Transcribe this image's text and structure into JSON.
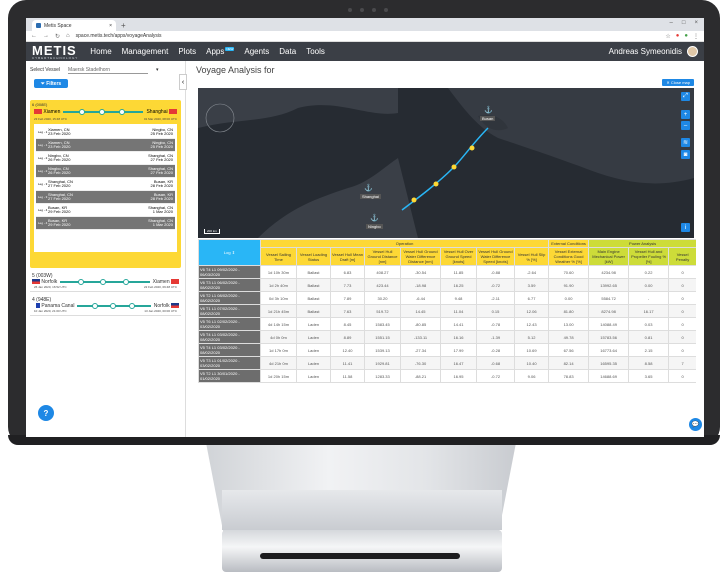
{
  "browser": {
    "tab_title": "Metis Space",
    "url": "space.metis.tech/apps/voyageAnalysis"
  },
  "app": {
    "logo": "METIS",
    "logo_sub": "CYBERTECHNOLOGY",
    "nav": [
      "Home",
      "Management",
      "Plots",
      "Apps",
      "Agents",
      "Data",
      "Tools"
    ],
    "new_badge": "NEW",
    "user_name": "Andreas Symeonidis"
  },
  "sidebar": {
    "select_label": "Select Vessel",
    "vessel": "Maersk Stadelhorn",
    "filters_label": "Filters",
    "voyage1": {
      "id": "6 (008E)",
      "from": "Xiamen",
      "to": "Shanghai",
      "start": "23 Feb 2020, 15:48 UTC",
      "end": "01 Mar 2020, 08:00 UTC",
      "legs": [
        {
          "no": "Leg - 1",
          "from": "Xiamen, CN",
          "fdate": "23 Feb 2020",
          "to": "Ningbo, CN",
          "tdate": "25 Feb 2020",
          "dark": false
        },
        {
          "no": "Leg - 1",
          "from": "Xiamen, CN",
          "fdate": "23 Feb 2020",
          "to": "Ningbo, CN",
          "tdate": "25 Feb 2020",
          "dark": true
        },
        {
          "no": "Leg - 2",
          "from": "Ningbo, CN",
          "fdate": "26 Feb 2020",
          "to": "Shanghai, CN",
          "tdate": "27 Feb 2020",
          "dark": false
        },
        {
          "no": "Leg - 2",
          "from": "Ningbo, CN",
          "fdate": "26 Feb 2020",
          "to": "Shanghai, CN",
          "tdate": "27 Feb 2020",
          "dark": true
        },
        {
          "no": "Leg - 3",
          "from": "Shanghai, CN",
          "fdate": "27 Feb 2020",
          "to": "Busan, KR",
          "tdate": "28 Feb 2020",
          "dark": false
        },
        {
          "no": "Leg - 3",
          "from": "Shanghai, CN",
          "fdate": "27 Feb 2020",
          "to": "Busan, KR",
          "tdate": "28 Feb 2020",
          "dark": true
        },
        {
          "no": "Leg - 4",
          "from": "Busan, KR",
          "fdate": "29 Feb 2020",
          "to": "Shanghai, CN",
          "tdate": "1 Mar 2020",
          "dark": false
        },
        {
          "no": "Leg - 4",
          "from": "Busan, KR",
          "fdate": "29 Feb 2020",
          "to": "Shanghai, CN",
          "tdate": "1 Mar 2020",
          "dark": true
        }
      ]
    },
    "voyage2": {
      "id": "5 (003W)",
      "from": "Norfolk",
      "to": "Xiamen",
      "start": "26 Jan 2020, 16:52 UTC",
      "end": "22 Feb 2020, 09:48 UTC"
    },
    "voyage3": {
      "id": "4 (948E)",
      "from": "Panama Canal",
      "to": "Norfolk",
      "start": "10 Jan 2020, 21:00 UTC",
      "end": "13 Jan 2020, 00:00 UTC"
    },
    "help": "?"
  },
  "main": {
    "title": "Voyage Analysis for",
    "close_map": "Close map",
    "map_labels": [
      "Busan",
      "Shanghai",
      "Ningbo"
    ],
    "scale": "200 km",
    "info": "i",
    "headers": {
      "log": "Log",
      "operation": "Operation",
      "external": "External Conditions",
      "power": "Power Analysis",
      "cols": [
        "Vessel Sailing Time",
        "Vessel Loading Status",
        "Vessel Hull Mean Draft [m]",
        "Vessel Hull Ground Distance [nm]",
        "Vessel Hull Ground Water Difference Distance [nm]",
        "Vessel Hull Over Ground Speed [knots]",
        "Vessel Hull Ground Water Difference Speed [knots]",
        "Vessel Hull Slip % [%]",
        "Vessel External Conditions Good Weather % [%]",
        "Main Engine Mechanical Power [kW]",
        "Vessel Hull and Propeller Fouling % [%]",
        "Vessel Penalty"
      ]
    },
    "rows": [
      [
        "V6 T4 L1 09/02/2020 - 06/03/2020",
        "1d 10h 30m",
        "Ballast",
        "6.83",
        "408.27",
        "-30.54",
        "11.85",
        "-0.88",
        "-2.64",
        "70.60",
        "4234.98",
        "0.22",
        "0"
      ],
      [
        "V6 T3 L1 06/02/2020 - 08/02/2020",
        "1d 2h 40m",
        "Ballast",
        "7.73",
        "423.44",
        "-18.98",
        "16.25",
        "-0.72",
        "3.59",
        "91.90",
        "13992.65",
        "0.00",
        "0"
      ],
      [
        "V6 T2 L1 08/02/2020 - 08/02/2020",
        "0d 3h 10m",
        "Ballast",
        "7.89",
        "30.20",
        "-6.44",
        "9.48",
        "-2.11",
        "6.77",
        "0.00",
        "5584.72",
        "-",
        "0"
      ],
      [
        "V6 T1 L1 07/02/2020 - 08/02/2020",
        "1d 21h 45m",
        "Ballast",
        "7.63",
        "519.72",
        "14.45",
        "11.04",
        "0.15",
        "12.06",
        "81.80",
        "8274.98",
        "16.17",
        "0"
      ],
      [
        "V5 T6 L1 02/02/2020 - 03/02/2020",
        "4d 14h 15m",
        "Laden",
        "8.45",
        "1583.45",
        "-80.85",
        "14.41",
        "-0.78",
        "12.43",
        "13.00",
        "14088.49",
        "0.03",
        "0"
      ],
      [
        "V5 T4 L1 03/02/2020 - 08/02/2020",
        "4d 0h 0m",
        "Laden",
        "8.89",
        "1551.15",
        "-133.11",
        "16.16",
        "-1.39",
        "5.12",
        "49.78",
        "15783.56",
        "0.81",
        "0"
      ],
      [
        "V5 T4 L1 03/02/2020 - 08/02/2020",
        "1d 17h 0m",
        "Laden",
        "12.40",
        "1539.13",
        "-27.34",
        "17.99",
        "-0.28",
        "10.69",
        "67.56",
        "16773.64",
        "2.15",
        "0"
      ],
      [
        "V5 T3 L1 01/02/2020 - 03/02/2020",
        "4d 21h 0m",
        "Laden",
        "11.41",
        "1929.81",
        "-76.30",
        "16.47",
        "-0.68",
        "10.40",
        "82.14",
        "16595.35",
        "8.58",
        "7"
      ],
      [
        "V5 T2 L1 30/01/2020 - 01/02/2020",
        "1d 20h 15m",
        "Laden",
        "11.58",
        "1283.33",
        "-88.21",
        "16.95",
        "-0.72",
        "9.06",
        "78.83",
        "14688.69",
        "3.65",
        "0"
      ]
    ]
  }
}
